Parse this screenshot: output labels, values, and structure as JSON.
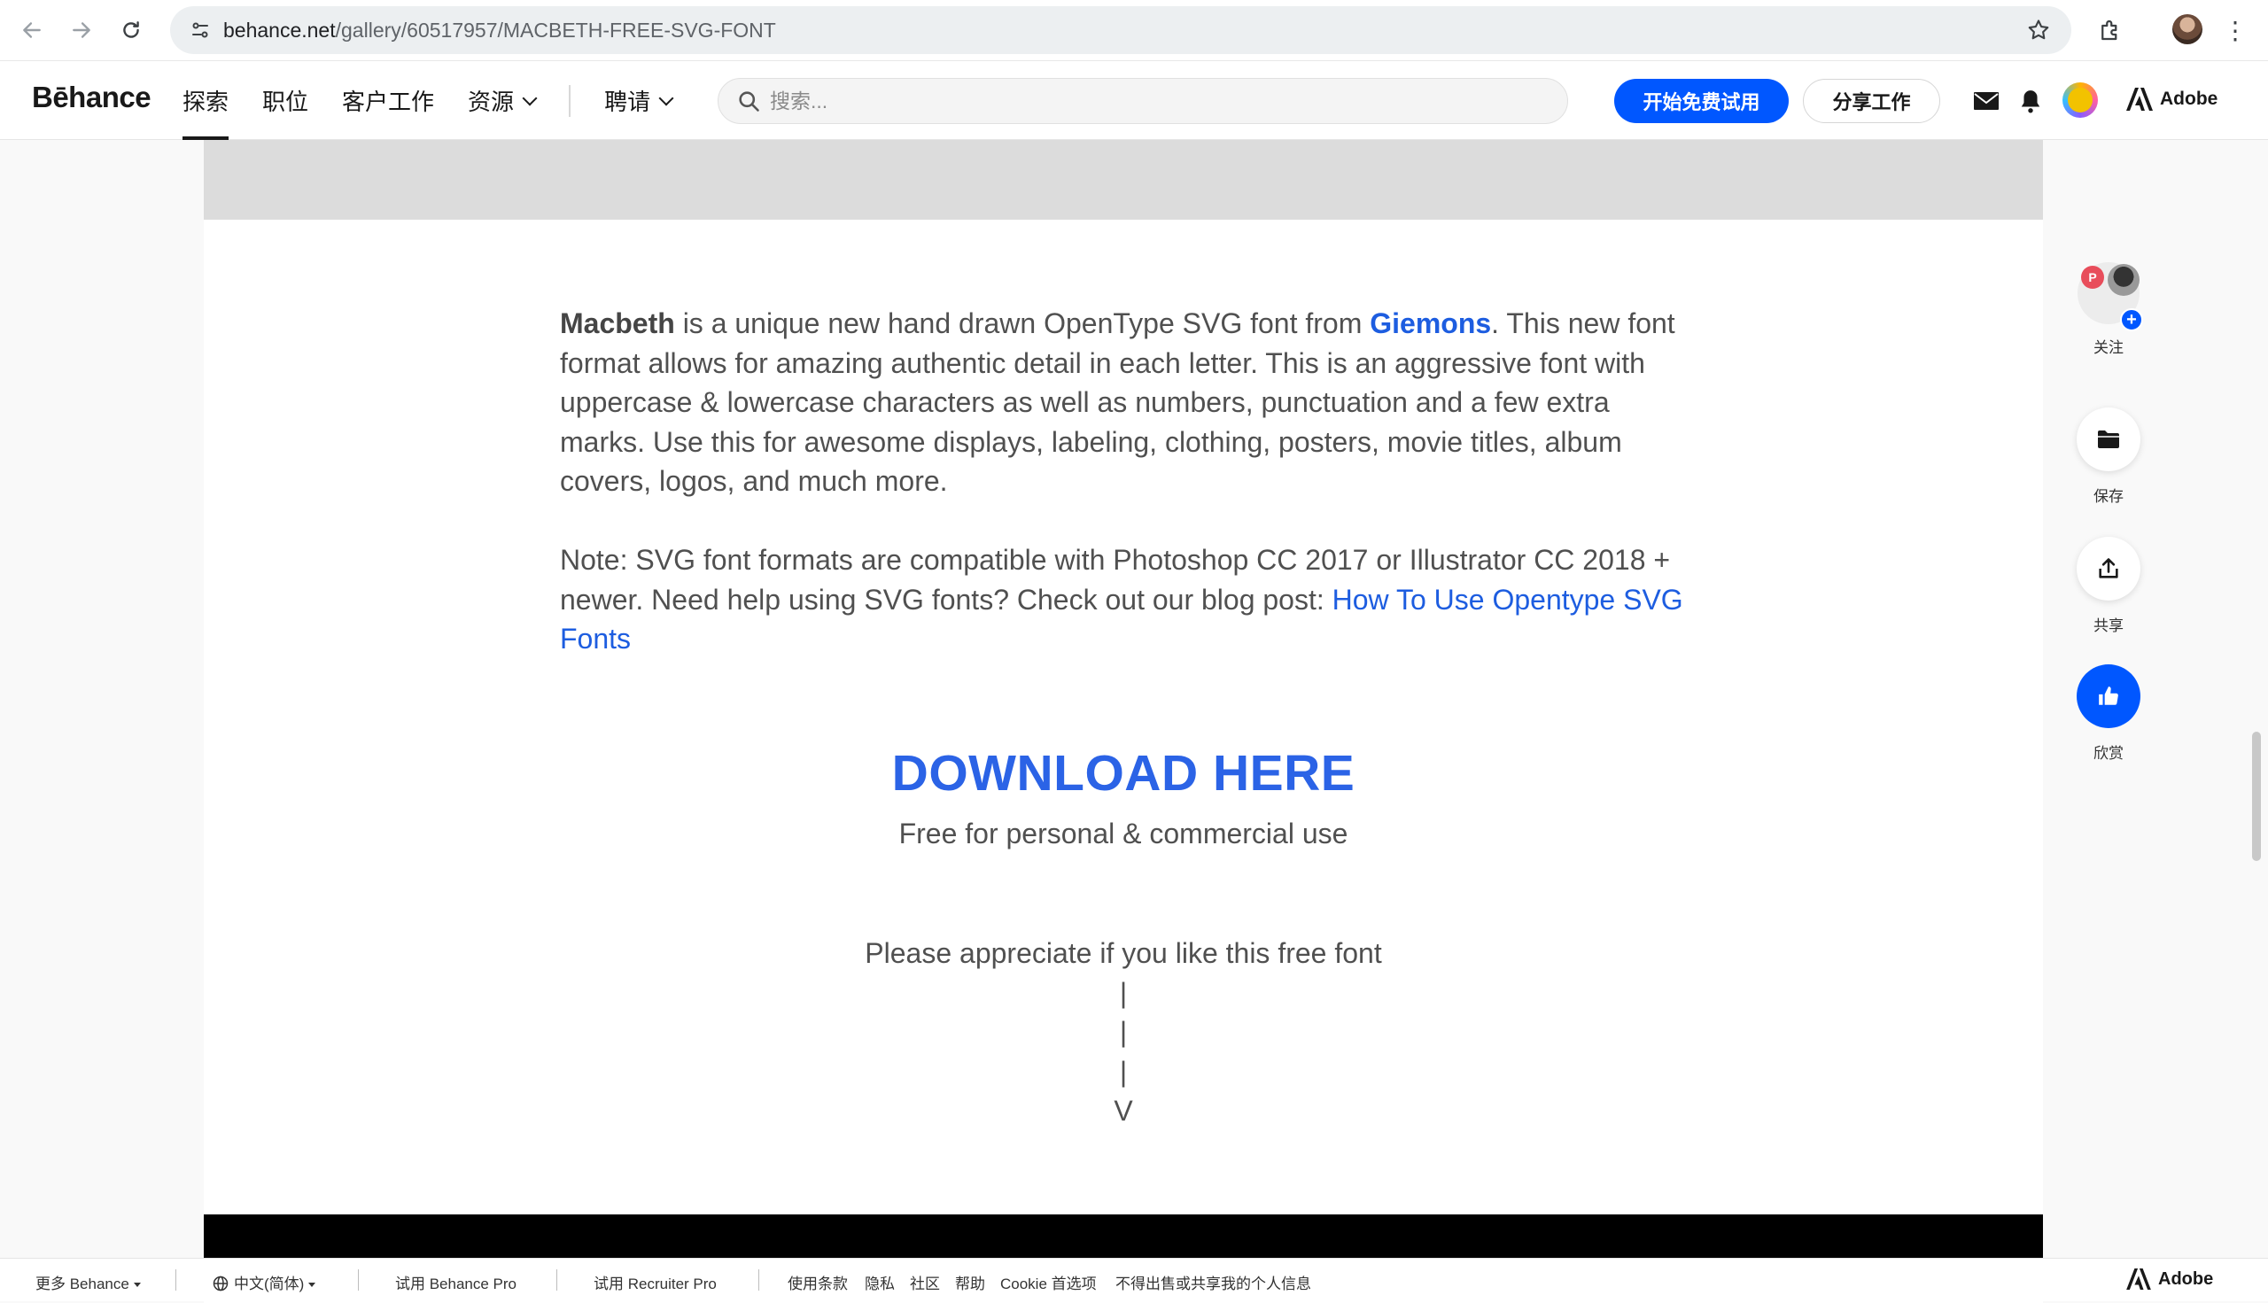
{
  "browser": {
    "url_host": "behance.net",
    "url_path": "/gallery/60517957/MACBETH-FREE-SVG-FONT"
  },
  "header": {
    "logo": "Bēhance",
    "nav": [
      "探索",
      "职位",
      "客户工作",
      "资源",
      "聘请"
    ],
    "search_placeholder": "搜索...",
    "cta_primary": "开始免费试用",
    "cta_secondary": "分享工作",
    "brand": "Adobe"
  },
  "content": {
    "desc_bold": "Macbeth",
    "desc_part1": " is a unique new hand drawn OpenType SVG font from ",
    "desc_link": "Giemons",
    "desc_part2": ". This new font format allows for amazing authentic detail in each letter. This is an aggressive font with uppercase & lowercase characters as well as numbers, punctuation and a few extra marks. Use this for awesome displays, labeling, clothing, posters, movie titles, album covers, logos, and much more.",
    "note_text": "Note: SVG font formats are compatible with Photoshop CC 2017 or Illustrator CC 2018 + newer. Need help using SVG fonts? Check out our blog post: ",
    "note_link": "How To Use Opentype SVG Fonts",
    "download": "DOWNLOAD HERE",
    "free_use": "Free for personal & commercial use",
    "appreciate": "Please appreciate if you like this free font",
    "arrow_lines": [
      "|",
      "|",
      "|",
      "V"
    ]
  },
  "side_actions": {
    "follow": "关注",
    "save": "保存",
    "share": "共享",
    "appreciate": "欣赏"
  },
  "footer": {
    "more": "更多 Behance",
    "language": "中文(简体)",
    "try_pro": "试用 Behance Pro",
    "try_recruiter": "试用 Recruiter Pro",
    "terms": "使用条款",
    "privacy": "隐私",
    "community": "社区",
    "help": "帮助",
    "cookie": "Cookie 首选项",
    "do_not_sell": "不得出售或共享我的个人信息",
    "brand": "Adobe"
  },
  "colors": {
    "accent": "#0057ff",
    "link": "#1d5de0",
    "download": "#2b63e6"
  }
}
